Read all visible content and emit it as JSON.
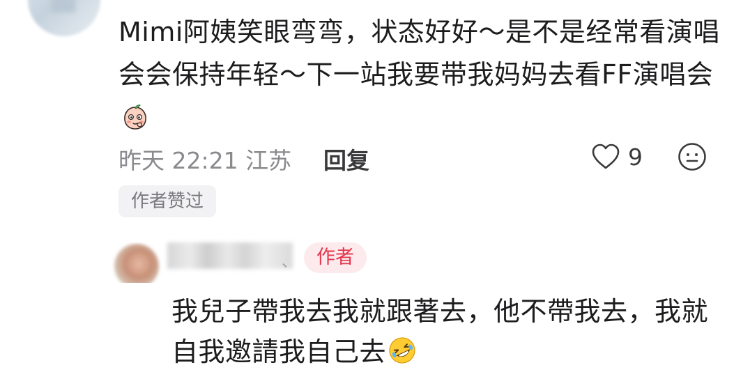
{
  "comment": {
    "text": "Mimi阿姨笑眼弯弯，状态好好～是不是经常看演唱会会保持年轻～下一站我要带我妈妈去看FF演唱会",
    "emoji": "peach-shy-emoji",
    "time_location": "昨天 22:21 江苏",
    "reply_label": "回复",
    "like_count": "9",
    "like_icon": "heart-outline-icon",
    "reaction_icon": "face-reaction-icon",
    "author_liked_tag": "作者赞过"
  },
  "reply": {
    "username_tail": "、",
    "author_badge": "作者",
    "text": "我兒子帶我去我就跟著去，他不帶我去，我就自我邀請我自己去",
    "emoji": "rofl-emoji"
  },
  "colors": {
    "accent_red": "#e2364d",
    "badge_bg": "#fdeaec",
    "muted_text": "#8a8a8e"
  }
}
